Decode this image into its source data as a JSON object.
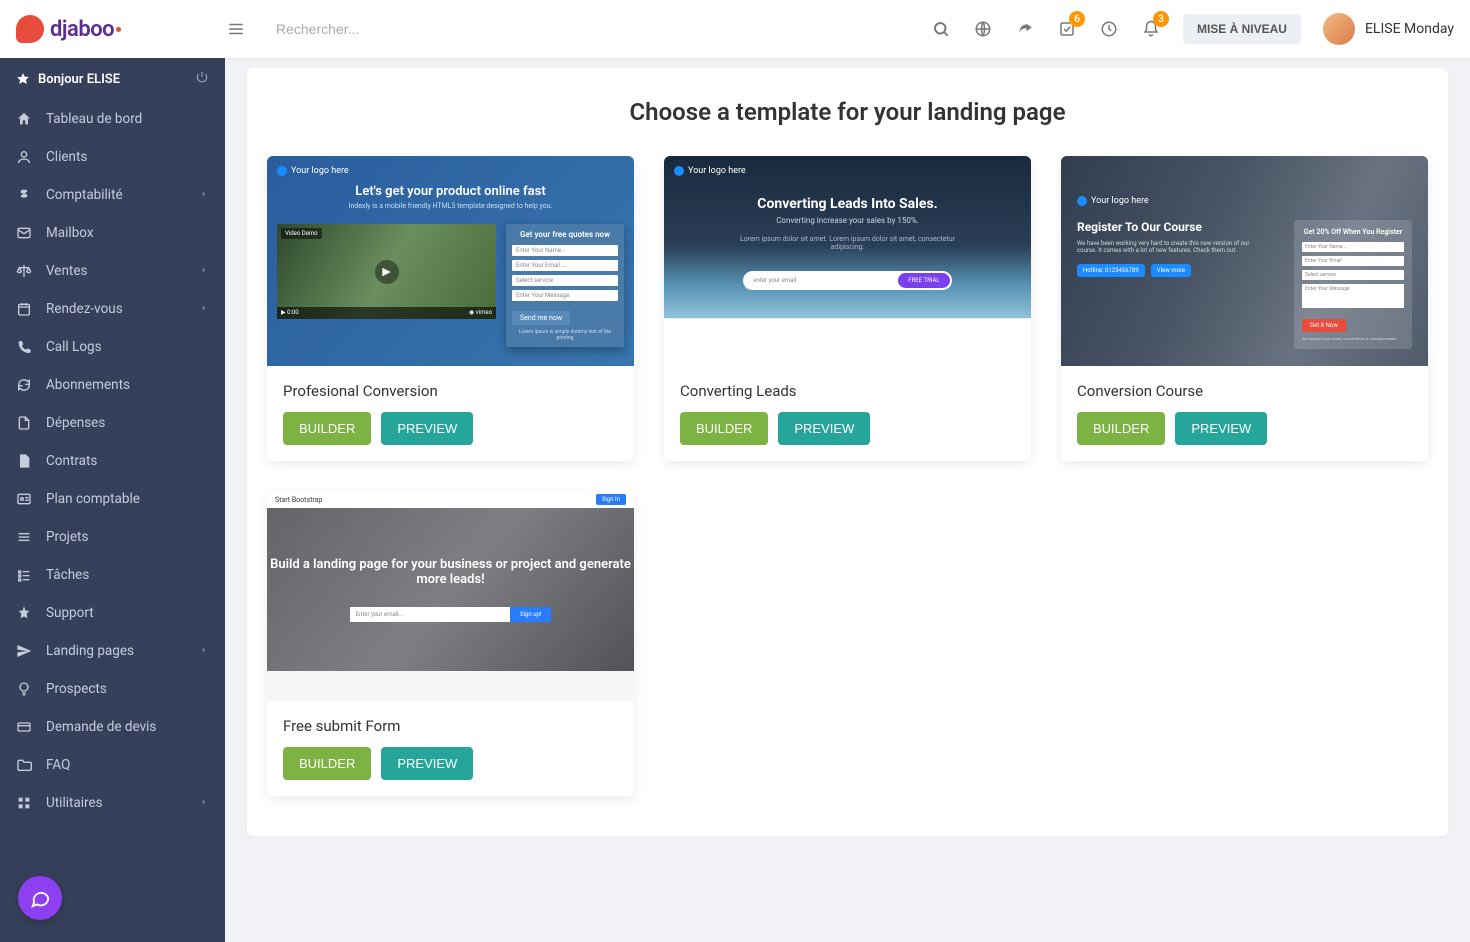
{
  "brand": "djaboo",
  "header": {
    "search_placeholder": "Rechercher...",
    "upgrade_label": "MISE À NIVEAU",
    "check_badge": "6",
    "bell_badge": "3",
    "user_name": "ELISE Monday"
  },
  "sidebar": {
    "greeting_label": "Bonjour ELISE",
    "items": [
      {
        "icon": "home",
        "label": "Tableau de bord",
        "expand": false
      },
      {
        "icon": "user",
        "label": "Clients",
        "expand": false
      },
      {
        "icon": "dollar",
        "label": "Comptabilité",
        "expand": true
      },
      {
        "icon": "mail",
        "label": "Mailbox",
        "expand": false
      },
      {
        "icon": "scale",
        "label": "Ventes",
        "expand": true
      },
      {
        "icon": "calendar",
        "label": "Rendez-vous",
        "expand": true
      },
      {
        "icon": "phone",
        "label": "Call Logs",
        "expand": false
      },
      {
        "icon": "refresh",
        "label": "Abonnements",
        "expand": false
      },
      {
        "icon": "file",
        "label": "Dépenses",
        "expand": false
      },
      {
        "icon": "doc",
        "label": "Contrats",
        "expand": false
      },
      {
        "icon": "id",
        "label": "Plan comptable",
        "expand": false
      },
      {
        "icon": "lines",
        "label": "Projets",
        "expand": false
      },
      {
        "icon": "tasks",
        "label": "Tâches",
        "expand": false
      },
      {
        "icon": "pin",
        "label": "Support",
        "expand": false
      },
      {
        "icon": "send",
        "label": "Landing pages",
        "expand": true
      },
      {
        "icon": "bulb",
        "label": "Prospects",
        "expand": false
      },
      {
        "icon": "card",
        "label": "Demande de devis",
        "expand": false
      },
      {
        "icon": "folder",
        "label": "FAQ",
        "expand": false
      },
      {
        "icon": "grid",
        "label": "Utilitaires",
        "expand": true
      }
    ]
  },
  "main": {
    "page_title": "Choose a template for your landing page",
    "builder_label": "BUILDER",
    "preview_label": "PREVIEW",
    "templates": [
      {
        "title": "Profesional Conversion",
        "thumb": {
          "logo": "Your logo here",
          "hero": "Let's get your product online fast",
          "sub": "Indexly is a mobile friendly HTML5 template designed to help you.",
          "form_title": "Get your free quotes now",
          "f1": "Enter Your Name...",
          "f2": "Enter Your Email ...",
          "f3": "Select service",
          "f4": "Enter Your Message",
          "btn": "Send me now",
          "note": "Lorem ipsum is simply dummy text of the printing",
          "video_tag": "Video Demo"
        }
      },
      {
        "title": "Converting Leads",
        "thumb": {
          "logo": "Your logo here",
          "hero": "Converting Leads Into Sales.",
          "sub": "Converting increase your sales by 150%.",
          "desc": "Lorem ipsum dolor sit amet. Lorem ipsum dolor sit amet, consectetur adipiscing.",
          "inp": "enter your email",
          "btn": "FREE TRIAL"
        }
      },
      {
        "title": "Conversion Course",
        "thumb": {
          "logo": "Your logo here",
          "hero": "Register To Our Course",
          "desc": "We have been working very hard to create this new version of our course. It comes with a lot of new features. Check them out.",
          "tag1": "Hotline: 0123456789",
          "tag2": "View more",
          "form_title": "Get 20% Off When You Register",
          "f1": "Enter Your Name...",
          "f2": "Enter Your Email",
          "f3": "Select service",
          "f4": "Enter Your Message",
          "btn": "Get it Now",
          "fnote": "We respect your email, consectetur or condimentalite"
        }
      },
      {
        "title": "Free submit Form",
        "thumb": {
          "brand": "Start Bootstrap",
          "signin": "Sign In",
          "hero": "Build a landing page for your business or project and generate more leads!",
          "desc": "",
          "inp": "Enter your email...",
          "btn": "Sign up!"
        }
      }
    ]
  }
}
